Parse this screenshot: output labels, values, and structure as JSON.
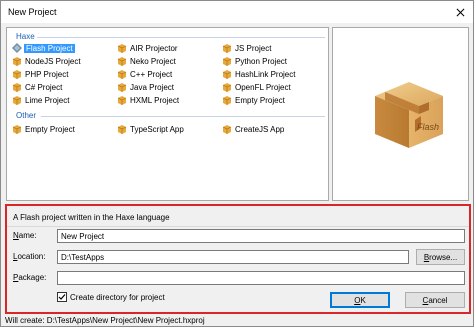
{
  "window": {
    "title": "New Project"
  },
  "groups": {
    "haxe_label": "Haxe",
    "other_label": "Other"
  },
  "templates": {
    "flash": "Flash Project",
    "air": "AIR Projector",
    "js": "JS Project",
    "nodejs": "NodeJS Project",
    "neko": "Neko Project",
    "python": "Python Project",
    "php": "PHP Project",
    "cpp": "C++ Project",
    "hashlink": "HashLink Project",
    "cs": "C# Project",
    "java": "Java Project",
    "openfl": "OpenFL Project",
    "lime": "Lime Project",
    "hxml": "HXML Project",
    "empty_haxe": "Empty Project",
    "empty_other": "Empty Project",
    "typescript": "TypeScript App",
    "createjs": "CreateJS App"
  },
  "selected_template": "Flash Project",
  "preview": {
    "box_label": "Flash"
  },
  "description": "A Flash project written in the Haxe language",
  "form": {
    "name_label_first": "N",
    "name_label_rest": "ame:",
    "name_value": "New Project",
    "location_label_first": "L",
    "location_label_rest": "ocation:",
    "location_value": "D:\\TestApps",
    "package_label_first": "P",
    "package_label_rest": "ackage:",
    "package_value": "",
    "browse_first": "B",
    "browse_rest": "rowse...",
    "create_dir_label": "Create directory for project",
    "create_dir_checked": true
  },
  "buttons": {
    "ok_first": "O",
    "ok_rest": "K",
    "cancel_first": "C",
    "cancel_rest": "ancel"
  },
  "status": "Will create: D:\\TestApps\\New Project\\New Project.hxproj",
  "colors": {
    "selection": "#3399ff",
    "group_header": "#1a5fb4",
    "highlight_border": "#d9262b",
    "icon_box": "#e8a93c"
  }
}
